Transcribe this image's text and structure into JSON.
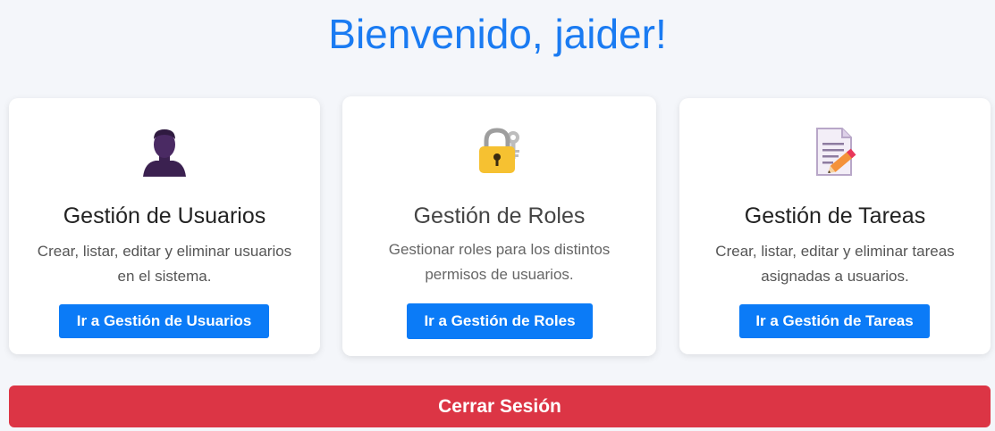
{
  "header": {
    "title": "Bienvenido, jaider!"
  },
  "cards": [
    {
      "icon": "user-silhouette-icon",
      "title": "Gestión de Usuarios",
      "description": "Crear, listar, editar y eliminar usuarios en el sistema.",
      "button_label": "Ir a Gestión de Usuarios"
    },
    {
      "icon": "lock-key-icon",
      "title": "Gestión de Roles",
      "description": "Gestionar roles para los distintos permisos de usuarios.",
      "button_label": "Ir a Gestión de Roles"
    },
    {
      "icon": "document-pencil-icon",
      "title": "Gestión de Tareas",
      "description": "Crear, listar, editar y eliminar tareas asignadas a usuarios.",
      "button_label": "Ir a Gestión de Tareas"
    }
  ],
  "footer": {
    "logout_label": "Cerrar Sesión"
  },
  "colors": {
    "background": "#f4f6fa",
    "title": "#1a7bf2",
    "primary_button": "#0b7bf7",
    "danger_button": "#dc3545"
  }
}
